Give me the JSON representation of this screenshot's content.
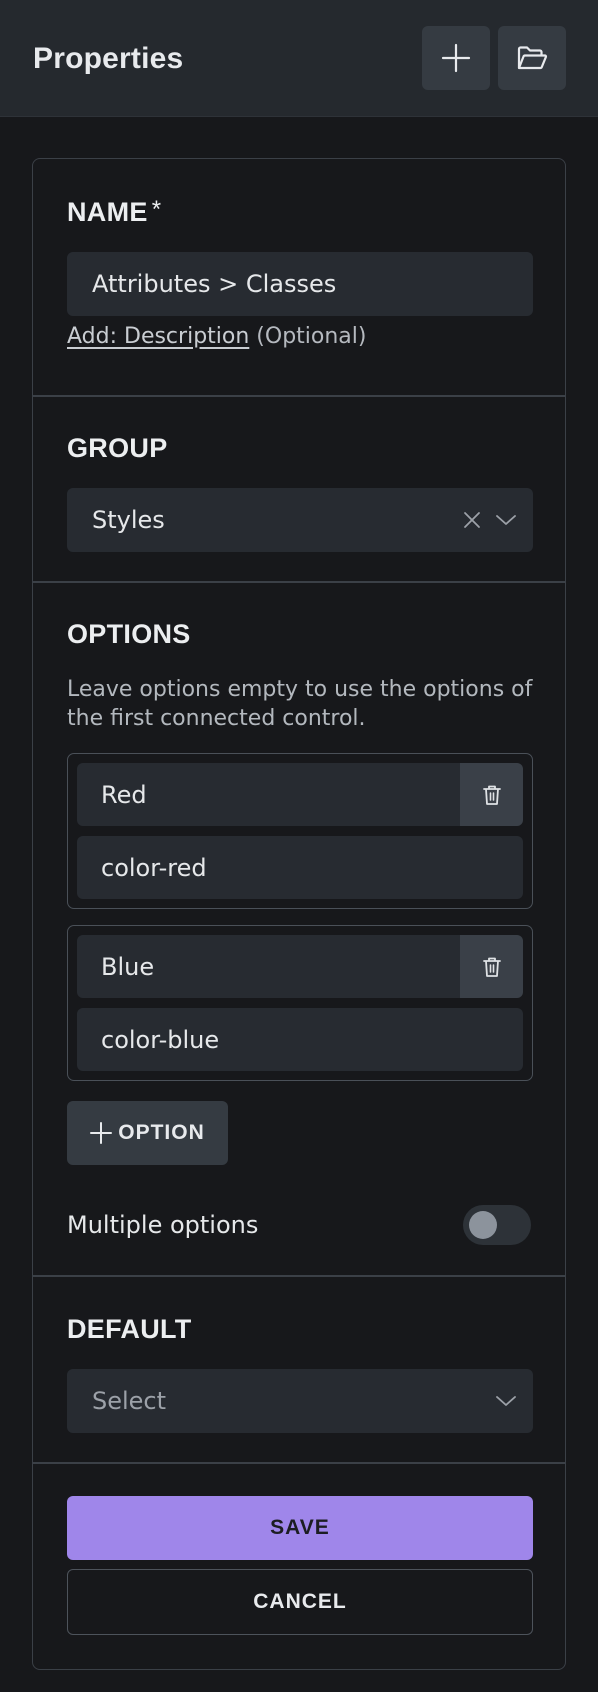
{
  "header": {
    "title": "Properties",
    "add_icon": "plus-icon",
    "open_icon": "folder-open-icon"
  },
  "name_section": {
    "title": "NAME",
    "required_mark": "*",
    "value": "Attributes > Classes",
    "add_description_link": "Add: Description",
    "optional_text": "(Optional)"
  },
  "group_section": {
    "title": "GROUP",
    "value": "Styles",
    "clear_icon": "close-icon",
    "dropdown_icon": "chevron-down-icon"
  },
  "options_section": {
    "title": "OPTIONS",
    "help_text": "Leave options empty to use the options of the first connected control.",
    "options": [
      {
        "label": "Red",
        "value": "color-red"
      },
      {
        "label": "Blue",
        "value": "color-blue"
      }
    ],
    "delete_icon": "trash-icon",
    "add_option_label": "OPTION",
    "multiple_label": "Multiple options",
    "multiple_enabled": false
  },
  "default_section": {
    "title": "DEFAULT",
    "placeholder": "Select",
    "dropdown_icon": "chevron-down-icon"
  },
  "actions": {
    "save_label": "SAVE",
    "cancel_label": "CANCEL"
  },
  "colors": {
    "accent": "#9f86ea",
    "background": "#17181b",
    "header": "#25292e",
    "field": "#272b31"
  }
}
